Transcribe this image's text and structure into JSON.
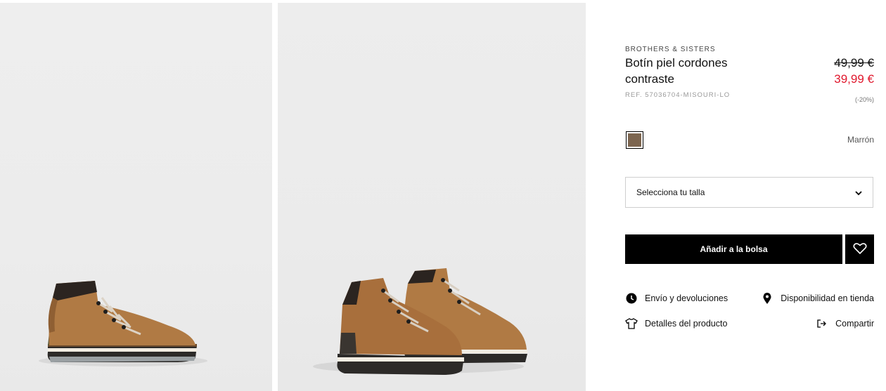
{
  "product": {
    "brand": "BROTHERS & SISTERS",
    "title": "Botín piel cordones contraste",
    "reference": "REF. 57036704-MISOURI-LO",
    "old_price": "49,99 €",
    "new_price": "39,99 €",
    "discount": "(-20%)"
  },
  "color": {
    "name": "Marrón",
    "swatch_hex": "#7d6650"
  },
  "size_selector": {
    "label": "Selecciona tu talla",
    "icon": "chevron-down-icon"
  },
  "actions": {
    "add_to_bag": "Añadir a la bolsa",
    "wishlist_icon": "heart-icon"
  },
  "links": {
    "shipping": "Envío y devoluciones",
    "availability": "Disponibilidad en tienda",
    "details": "Detalles del producto",
    "share": "Compartir"
  },
  "colors": {
    "accent_price": "#e0182d",
    "button_bg": "#000000",
    "suede": "#b07a44"
  }
}
